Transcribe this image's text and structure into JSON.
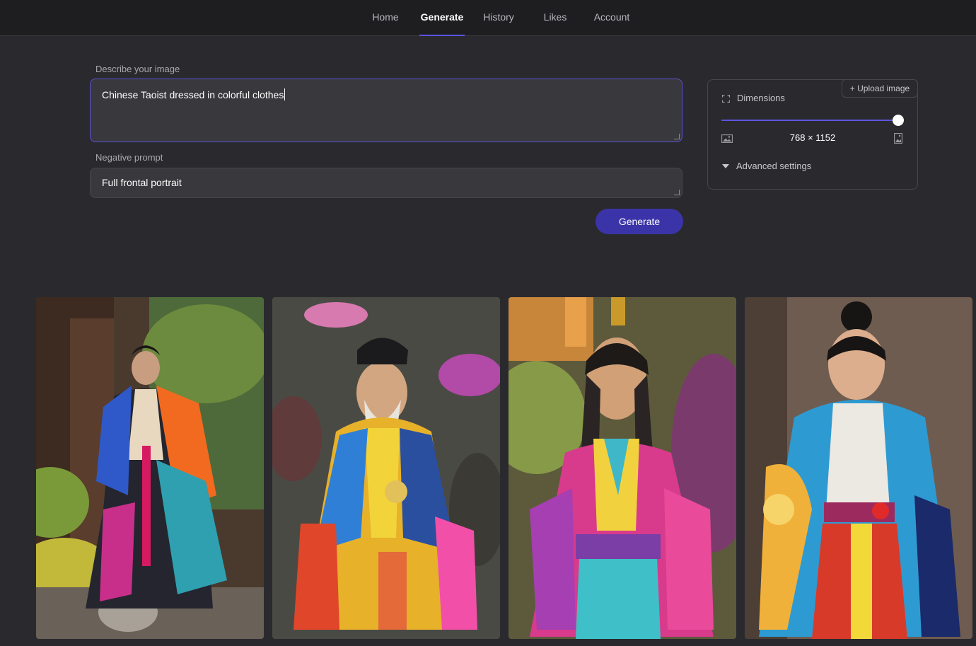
{
  "nav": {
    "tabs": [
      {
        "label": "Home",
        "active": false
      },
      {
        "label": "Generate",
        "active": true
      },
      {
        "label": "History",
        "active": false
      },
      {
        "label": "Likes",
        "active": false
      },
      {
        "label": "Account",
        "active": false
      }
    ]
  },
  "form": {
    "prompt_label": "Describe your image",
    "prompt_value": "Chinese Taoist dressed in colorful clothes",
    "negative_label": "Negative prompt",
    "negative_value": "Full frontal portrait",
    "generate_label": "Generate"
  },
  "settings": {
    "upload_label": "+ Upload image",
    "dimensions_label": "Dimensions",
    "dimensions_value": "768 × 1152",
    "slider_level": 1.0,
    "advanced_label": "Advanced settings"
  },
  "gallery": {
    "images": [
      {
        "name": "generated-image-1"
      },
      {
        "name": "generated-image-2"
      },
      {
        "name": "generated-image-3"
      },
      {
        "name": "generated-image-4"
      }
    ]
  },
  "colors": {
    "background": "#2a2a2e",
    "nav_background": "#1e1e21",
    "accent": "#5b54e0",
    "button": "#3b34a8"
  }
}
